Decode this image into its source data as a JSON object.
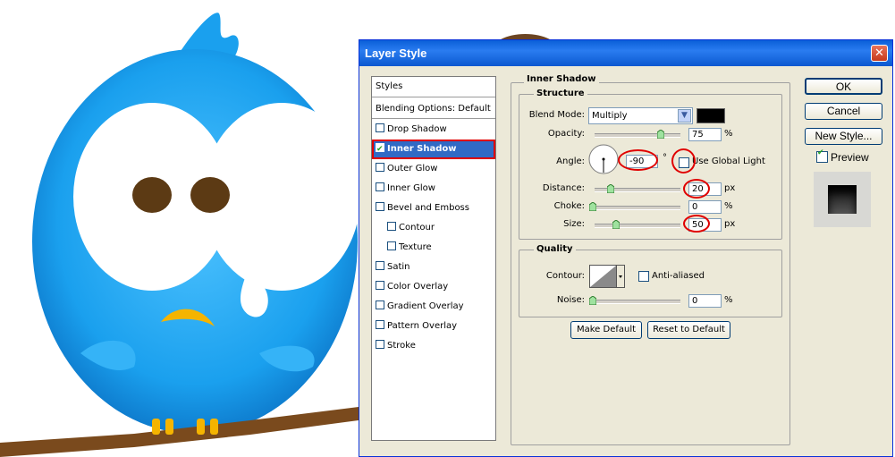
{
  "dialog": {
    "title": "Layer Style",
    "close_label": "✕",
    "styles_header": "Styles",
    "blending_options": "Blending Options: Default",
    "style_items": [
      {
        "label": "Drop Shadow",
        "checked": false,
        "indent": false,
        "selected": false
      },
      {
        "label": "Inner Shadow",
        "checked": true,
        "indent": false,
        "selected": true
      },
      {
        "label": "Outer Glow",
        "checked": false,
        "indent": false,
        "selected": false
      },
      {
        "label": "Inner Glow",
        "checked": false,
        "indent": false,
        "selected": false
      },
      {
        "label": "Bevel and Emboss",
        "checked": false,
        "indent": false,
        "selected": false
      },
      {
        "label": "Contour",
        "checked": false,
        "indent": true,
        "selected": false
      },
      {
        "label": "Texture",
        "checked": false,
        "indent": true,
        "selected": false
      },
      {
        "label": "Satin",
        "checked": false,
        "indent": false,
        "selected": false
      },
      {
        "label": "Color Overlay",
        "checked": false,
        "indent": false,
        "selected": false
      },
      {
        "label": "Gradient Overlay",
        "checked": false,
        "indent": false,
        "selected": false
      },
      {
        "label": "Pattern Overlay",
        "checked": false,
        "indent": false,
        "selected": false
      },
      {
        "label": "Stroke",
        "checked": false,
        "indent": false,
        "selected": false
      }
    ],
    "section_title": "Inner Shadow",
    "structure": {
      "label": "Structure",
      "blend_mode_label": "Blend Mode:",
      "blend_mode_value": "Multiply",
      "shadow_color": "#000000",
      "opacity_label": "Opacity:",
      "opacity_value": "75",
      "opacity_unit": "%",
      "angle_label": "Angle:",
      "angle_value": "-90",
      "angle_unit": "°",
      "global_light_label": "Use Global Light",
      "distance_label": "Distance:",
      "distance_value": "20",
      "distance_unit": "px",
      "choke_label": "Choke:",
      "choke_value": "0",
      "choke_unit": "%",
      "size_label": "Size:",
      "size_value": "50",
      "size_unit": "px"
    },
    "quality": {
      "label": "Quality",
      "contour_label": "Contour:",
      "anti_aliased_label": "Anti-aliased",
      "noise_label": "Noise:",
      "noise_value": "0",
      "noise_unit": "%"
    },
    "make_default": "Make Default",
    "reset_default": "Reset to Default",
    "ok": "OK",
    "cancel": "Cancel",
    "new_style": "New Style...",
    "preview_label": "Preview"
  },
  "colors": {
    "accent_selected": "#316ac5",
    "annotation_red": "#e00000",
    "bird_blue": "#1b9ae8"
  }
}
